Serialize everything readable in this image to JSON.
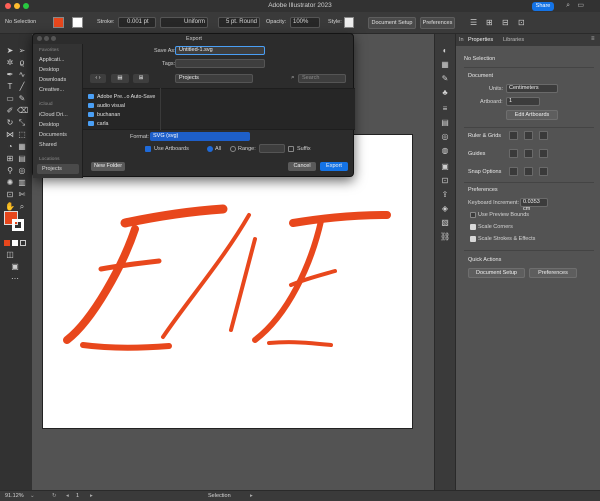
{
  "app": {
    "title": "Adobe Illustrator 2023",
    "share": "Share"
  },
  "control_bar": {
    "selection": "No Selection",
    "stroke_label": "Stroke:",
    "stroke_value": "0.001 pt",
    "profile": "Uniform",
    "brush": "5 pt. Round",
    "opacity_label": "Opacity:",
    "opacity_value": "100%",
    "style_label": "Style:",
    "doc_setup": "Document Setup",
    "preferences": "Preferences"
  },
  "dialog": {
    "title": "Export",
    "save_as_label": "Save As:",
    "save_as_value": "Untitled-1.svg",
    "tags_label": "Tags:",
    "location": "Projects",
    "search_placeholder": "Search",
    "sidebar": {
      "favorites_label": "Favorites",
      "favorites": [
        "Applicati...",
        "Desktop",
        "Downloads",
        "Creative..."
      ],
      "icloud_label": "iCloud",
      "icloud": [
        "iCloud Dri...",
        "Desktop",
        "Documents",
        "Shared"
      ],
      "locations_label": "Locations",
      "locations": [
        "Projects"
      ]
    },
    "files": [
      "Adobe Pre...o Auto-Save",
      "audio visual",
      "buchanan",
      "carla"
    ],
    "format_label": "Format:",
    "format_value": "SVG (svg)",
    "use_artboards": "Use Artboards",
    "all_label": "All",
    "range_label": "Range:",
    "suffix_label": "Suffix",
    "new_folder": "New Folder",
    "cancel": "Cancel",
    "export": "Export"
  },
  "panel": {
    "tabs": [
      "In",
      "Properties",
      "Libraries"
    ],
    "no_selection": "No Selection",
    "document_head": "Document",
    "units_label": "Units:",
    "units_value": "Centimeters",
    "artboard_label": "Artboard:",
    "artboard_value": "1",
    "edit_artboards": "Edit Artboards",
    "ruler_grids": "Ruler & Grids",
    "guides": "Guides",
    "snap_options": "Snap Options",
    "preferences_head": "Preferences",
    "keyboard_increment_label": "Keyboard Increment:",
    "keyboard_increment_value": "0.0353 cm",
    "use_preview_bounds": "Use Preview Bounds",
    "scale_corners": "Scale Corners",
    "scale_strokes": "Scale Strokes & Effects",
    "quick_actions": "Quick Actions",
    "document_setup": "Document Setup",
    "preferences_btn": "Preferences"
  },
  "status": {
    "zoom": "91.12%",
    "artboard": "1",
    "mode": "Selection"
  },
  "colors": {
    "fill": "#e8471c",
    "accent": "#1473e6",
    "lettering": "#e8471c"
  }
}
